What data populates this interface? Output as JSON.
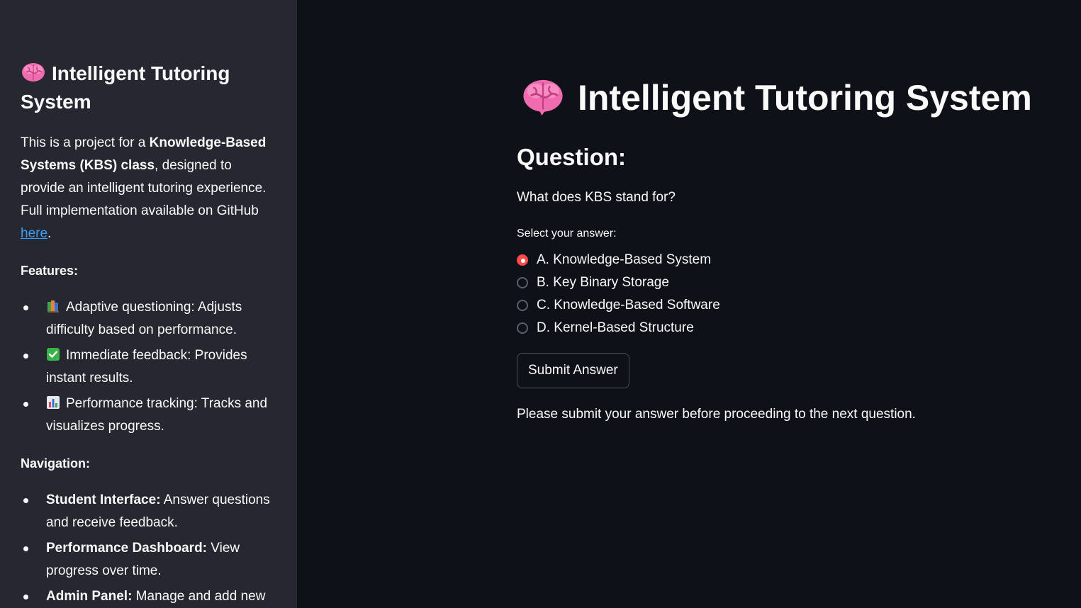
{
  "sidebar": {
    "title": "Intelligent Tutoring System",
    "title_icon": "brain-icon",
    "description": {
      "intro": "This is a project for a ",
      "bold": "Knowledge-Based Systems (KBS) class",
      "rest": ", designed to provide an intelligent tutoring experience. Full implementation available on GitHub ",
      "link": "here",
      "end": "."
    },
    "features_heading": "Features:",
    "features": [
      {
        "icon": "books-icon",
        "text": "Adaptive questioning: Adjusts difficulty based on performance."
      },
      {
        "icon": "check-mark-icon",
        "text": "Immediate feedback: Provides instant results."
      },
      {
        "icon": "bar-chart-icon",
        "text": "Performance tracking: Tracks and visualizes progress."
      }
    ],
    "navigation_heading": "Navigation:",
    "navigation": [
      {
        "bold": "Student Interface:",
        "text": " Answer questions and receive feedback."
      },
      {
        "bold": "Performance Dashboard:",
        "text": " View progress over time."
      },
      {
        "bold": "Admin Panel:",
        "text": " Manage and add new questions."
      }
    ]
  },
  "main": {
    "title": "Intelligent Tutoring System",
    "title_icon": "brain-icon",
    "question_heading": "Question:",
    "question_text": "What does KBS stand for?",
    "select_label": "Select your answer:",
    "options": [
      "A. Knowledge-Based System",
      "B. Key Binary Storage",
      "C. Knowledge-Based Software",
      "D. Kernel-Based Structure"
    ],
    "selected_option": "A. Knowledge-Based System",
    "submit_label": "Submit Answer",
    "notice": "Please submit your answer before proceeding to the next question."
  },
  "colors": {
    "background": "#0e1117",
    "sidebar_background": "#262730",
    "accent": "#ff4b4b",
    "link": "#3d9df3",
    "brain": "#f06bb0"
  }
}
